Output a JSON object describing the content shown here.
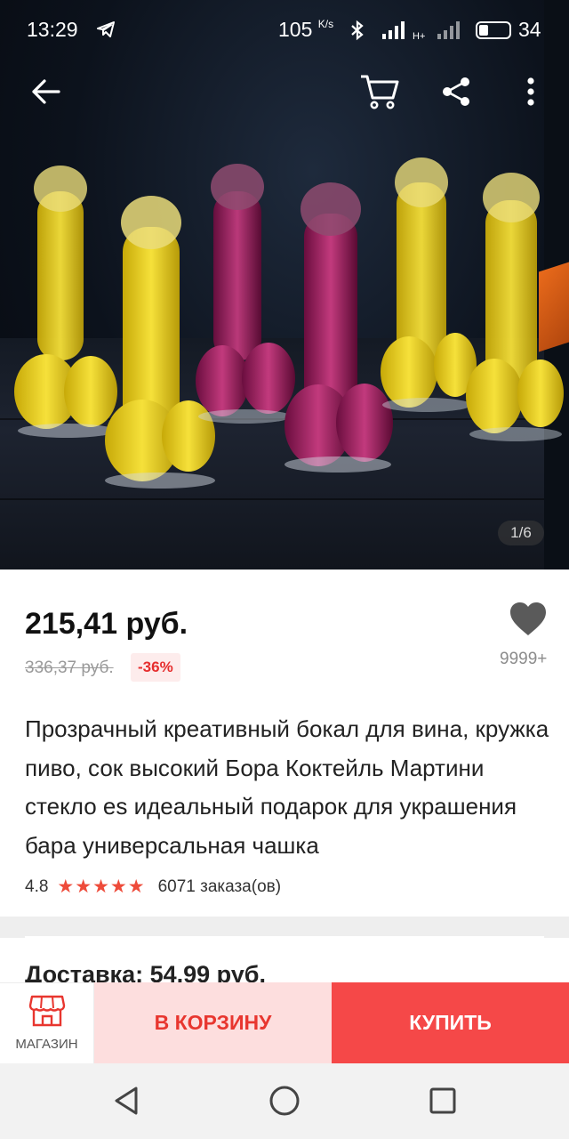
{
  "status_bar": {
    "time": "13:29",
    "net_speed": "105",
    "net_speed_unit": "K/s",
    "battery_percent": "34",
    "icons": [
      "telegram-icon",
      "bluetooth-icon",
      "signal-icon",
      "signal-icon"
    ]
  },
  "top_nav": {
    "icons": [
      "back-arrow-icon",
      "cart-icon",
      "share-icon",
      "more-vertical-icon"
    ]
  },
  "gallery": {
    "counter": "1/6"
  },
  "product": {
    "price": "215,41 руб.",
    "old_price": "336,37 руб.",
    "discount": "-36%",
    "wishlist_count": "9999+",
    "title": "Прозрачный креативный бокал для вина, кружка пиво, сок высокий Бора Коктейль Мартини стекло es идеальный подарок для украшения бара универсальная чашка",
    "rating": "4.8",
    "stars": "★★★★★",
    "orders": "6071 заказа(ов)"
  },
  "delivery": {
    "label": "Доставка: 54,99 руб."
  },
  "actions": {
    "store_label": "МАГАЗИН",
    "add_to_cart_label": "В КОРЗИНУ",
    "buy_label": "КУПИТЬ"
  },
  "colors": {
    "accent": "#f54848",
    "accent_light": "#fddede",
    "discount_text": "#e62e2e",
    "star": "#ee4b3a"
  }
}
